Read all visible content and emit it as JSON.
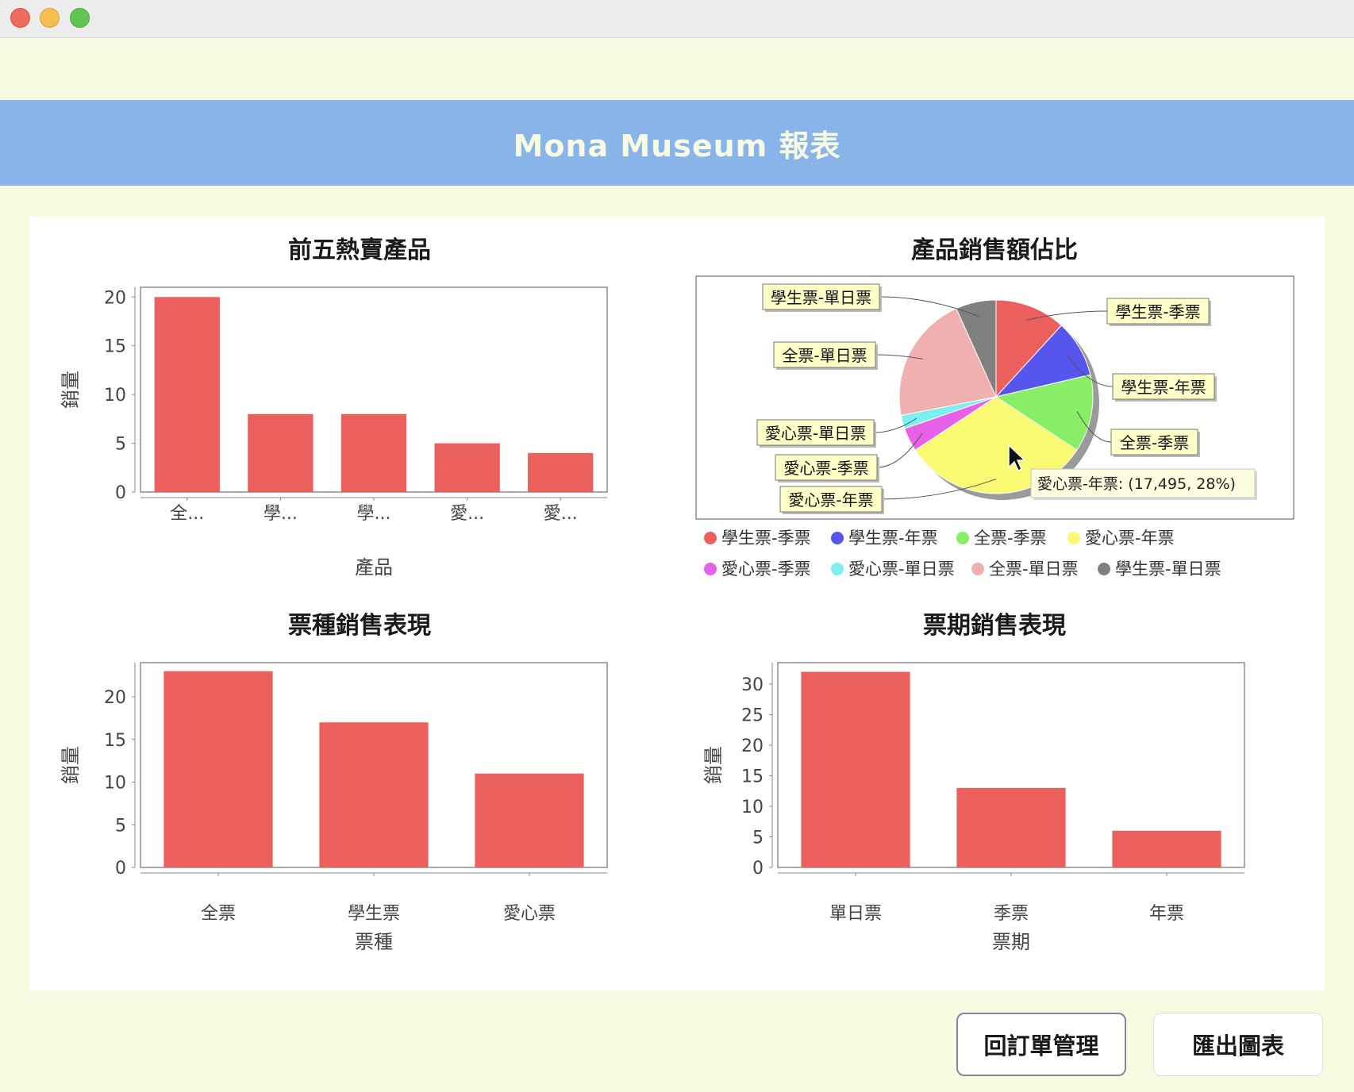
{
  "window": {
    "title": "Mona Museum 報表"
  },
  "colors": {
    "bar": "#eb605c",
    "header": "#89b4ea",
    "background": "#f7fbe1"
  },
  "buttons": {
    "back_label": "回訂單管理",
    "export_label": "匯出圖表"
  },
  "tooltip": {
    "text": "愛心票-年票: (17,495, 28%)"
  },
  "chart_data": [
    {
      "type": "bar",
      "title": "前五熱賣產品",
      "xlabel": "產品",
      "ylabel": "銷量",
      "categories": [
        "全...",
        "學...",
        "學...",
        "愛...",
        "愛..."
      ],
      "values": [
        20,
        8,
        8,
        5,
        4
      ],
      "ylim": [
        0,
        21
      ],
      "yticks": [
        0,
        5,
        10,
        15,
        20
      ],
      "grid": false
    },
    {
      "type": "pie",
      "title": "產品銷售額佔比",
      "slices": [
        {
          "label": "學生票-季票",
          "value": 10.5,
          "color": "#eb605c"
        },
        {
          "label": "學生票-年票",
          "value": 8.5,
          "color": "#5656ee"
        },
        {
          "label": "全票-季票",
          "value": 11.5,
          "color": "#88ee66"
        },
        {
          "label": "愛心票-年票",
          "value": 28,
          "color": "#fafa72"
        },
        {
          "label": "愛心票-季票",
          "value": 3.5,
          "color": "#e860e8"
        },
        {
          "label": "愛心票-單日票",
          "value": 2,
          "color": "#7cf0f0"
        },
        {
          "label": "全票-單日票",
          "value": 19,
          "color": "#f0b0b0"
        },
        {
          "label": "學生票-單日票",
          "value": 6,
          "color": "#808080"
        }
      ],
      "legend": "bottom"
    },
    {
      "type": "bar",
      "title": "票種銷售表現",
      "xlabel": "票種",
      "ylabel": "銷量",
      "categories": [
        "全票",
        "學生票",
        "愛心票"
      ],
      "values": [
        23,
        17,
        11
      ],
      "ylim": [
        0,
        24
      ],
      "yticks": [
        0,
        5,
        10,
        15,
        20
      ],
      "grid": false
    },
    {
      "type": "bar",
      "title": "票期銷售表現",
      "xlabel": "票期",
      "ylabel": "銷量",
      "categories": [
        "單日票",
        "季票",
        "年票"
      ],
      "values": [
        32,
        13,
        6
      ],
      "ylim": [
        0,
        33.5
      ],
      "yticks": [
        0,
        5,
        10,
        15,
        20,
        25,
        30
      ],
      "grid": false
    }
  ]
}
